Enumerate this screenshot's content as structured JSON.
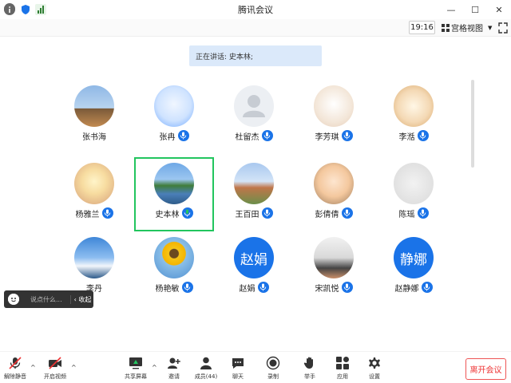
{
  "window": {
    "title": "腾讯会议"
  },
  "toolbar": {
    "time": "19:16",
    "view_mode": "宫格视图"
  },
  "speaking": {
    "text": "正在讲话: 史本林;"
  },
  "participants": [
    {
      "name": "张书海",
      "kind": "photo",
      "photo": "sky-tree",
      "mic": false
    },
    {
      "name": "张冉",
      "kind": "photo",
      "photo": "cartoon",
      "mic": true
    },
    {
      "name": "杜留杰",
      "kind": "default",
      "mic": true
    },
    {
      "name": "李芳琪",
      "kind": "photo",
      "photo": "cartoon-girl",
      "mic": true
    },
    {
      "name": "李湉",
      "kind": "photo",
      "photo": "cartoon-family",
      "mic": true
    },
    {
      "name": "杨雅兰",
      "kind": "photo",
      "photo": "anime",
      "mic": true
    },
    {
      "name": "史本林",
      "kind": "photo",
      "photo": "lake",
      "mic": true,
      "speaking": true
    },
    {
      "name": "王百田",
      "kind": "photo",
      "photo": "campus",
      "mic": true
    },
    {
      "name": "彭倩倩",
      "kind": "photo",
      "photo": "child",
      "mic": true
    },
    {
      "name": "陈瑶",
      "kind": "photo",
      "photo": "silhouette",
      "mic": true
    },
    {
      "name": "李丹",
      "kind": "photo",
      "photo": "cloud",
      "mic": false
    },
    {
      "name": "杨艳敏",
      "kind": "photo",
      "photo": "sunflower",
      "mic": true
    },
    {
      "name": "赵娟",
      "kind": "text",
      "initials": "赵娟",
      "mic": true
    },
    {
      "name": "宋凯悦",
      "kind": "photo",
      "photo": "family",
      "mic": true
    },
    {
      "name": "赵静娜",
      "kind": "text",
      "initials": "静娜",
      "mic": true
    }
  ],
  "chat": {
    "placeholder": "说点什么...",
    "collapse": "收起"
  },
  "bottom": {
    "unmute": "解除静音",
    "video": "开启视频",
    "share": "共享屏幕",
    "invite": "邀请",
    "members": "成员(44)",
    "chat": "聊天",
    "record": "录制",
    "raise": "举手",
    "apps": "应用",
    "settings": "设置",
    "leave": "离开会议"
  },
  "colors": {
    "accent": "#1a73e8",
    "speaking_border": "#22c55e",
    "leave": "#e33333"
  }
}
